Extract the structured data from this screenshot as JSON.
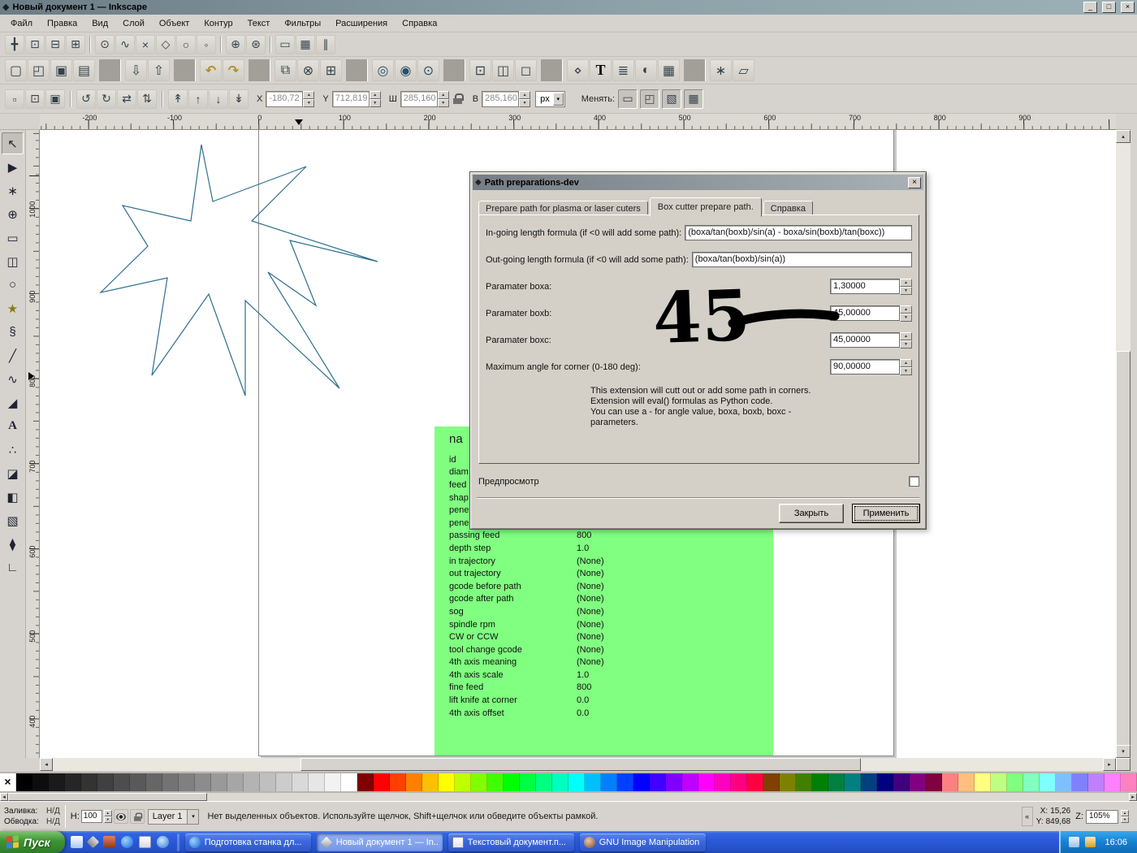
{
  "colors": {
    "ui_gray": "#d6d3ce",
    "dialog_gray": "#d4d0c8",
    "panel_green": "#80ff80",
    "taskbar_blue": "#2b59d8",
    "star_stroke": "#2e6f8e"
  },
  "titlebar": {
    "logo_glyph": "◆",
    "title": "Новый документ 1 — Inkscape",
    "minimize": "_",
    "maximize": "□",
    "close": "×"
  },
  "menubar": {
    "items": [
      "Файл",
      "Правка",
      "Вид",
      "Слой",
      "Объект",
      "Контур",
      "Текст",
      "Фильтры",
      "Расширения",
      "Справка"
    ]
  },
  "snapbar": {
    "icons": [
      {
        "name": "snap-enable-icon",
        "glyph": "╋"
      },
      {
        "name": "snap-bbox-icon",
        "glyph": "⊡"
      },
      {
        "name": "snap-bbox-edges-icon",
        "glyph": "⊟"
      },
      {
        "name": "snap-bbox-corners-icon",
        "glyph": "⊞"
      },
      {
        "name": "toolbar-separator",
        "glyph": ""
      },
      {
        "name": "snap-nodes-icon",
        "glyph": "⊙"
      },
      {
        "name": "snap-paths-icon",
        "glyph": "∿"
      },
      {
        "name": "snap-intersections-icon",
        "glyph": "×"
      },
      {
        "name": "snap-cusp-nodes-icon",
        "glyph": "◇"
      },
      {
        "name": "snap-smooth-nodes-icon",
        "glyph": "○"
      },
      {
        "name": "snap-midpoints-icon",
        "glyph": "◦"
      },
      {
        "name": "toolbar-separator",
        "glyph": ""
      },
      {
        "name": "snap-object-centers-icon",
        "glyph": "⊕"
      },
      {
        "name": "snap-rotation-centers-icon",
        "glyph": "⊛"
      },
      {
        "name": "toolbar-separator",
        "glyph": ""
      },
      {
        "name": "snap-page-border-icon",
        "glyph": "▭"
      },
      {
        "name": "snap-grid-icon",
        "glyph": "▦"
      },
      {
        "name": "snap-guides-icon",
        "glyph": "∥"
      }
    ]
  },
  "commands": {
    "icons": [
      {
        "name": "new-document-icon",
        "glyph": "▢"
      },
      {
        "name": "open-document-icon",
        "glyph": "◰"
      },
      {
        "name": "save-document-icon",
        "glyph": "▣"
      },
      {
        "name": "print-icon",
        "glyph": "▤"
      },
      {
        "name": "toolbar-separator",
        "glyph": ""
      },
      {
        "name": "import-icon",
        "glyph": "⇩"
      },
      {
        "name": "export-icon",
        "glyph": "⇧"
      },
      {
        "name": "toolbar-separator",
        "glyph": ""
      },
      {
        "name": "undo-icon",
        "glyph": "↶"
      },
      {
        "name": "redo-icon",
        "glyph": "↷"
      },
      {
        "name": "toolbar-separator",
        "glyph": ""
      },
      {
        "name": "copy-icon",
        "glyph": "⧉"
      },
      {
        "name": "cut-icon",
        "glyph": "⊗"
      },
      {
        "name": "paste-icon",
        "glyph": "⊞"
      },
      {
        "name": "toolbar-separator",
        "glyph": ""
      },
      {
        "name": "zoom-selection-icon",
        "glyph": "◎"
      },
      {
        "name": "zoom-drawing-icon",
        "glyph": "◉"
      },
      {
        "name": "zoom-page-icon",
        "glyph": "⊙"
      },
      {
        "name": "toolbar-separator",
        "glyph": ""
      },
      {
        "name": "duplicate-icon",
        "glyph": "⊡"
      },
      {
        "name": "create-clone-icon",
        "glyph": "◫"
      },
      {
        "name": "unlink-clone-icon",
        "glyph": "◻"
      },
      {
        "name": "toolbar-separator",
        "glyph": ""
      },
      {
        "name": "xml-editor-icon",
        "glyph": "⋄"
      },
      {
        "name": "text-and-font-icon",
        "glyph": "T"
      },
      {
        "name": "layers-dialog-icon",
        "glyph": "≣"
      },
      {
        "name": "fill-stroke-dialog-icon",
        "glyph": "◐"
      },
      {
        "name": "align-dialog-icon",
        "glyph": "▦"
      },
      {
        "name": "toolbar-separator",
        "glyph": ""
      },
      {
        "name": "preferences-icon",
        "glyph": "∗"
      },
      {
        "name": "document-properties-icon",
        "glyph": "▱"
      }
    ]
  },
  "tool_controls": {
    "select_icons": [
      {
        "name": "select-all-icon",
        "glyph": "▫"
      },
      {
        "name": "select-all-layers-icon",
        "glyph": "⊡"
      },
      {
        "name": "deselect-icon",
        "glyph": "▣"
      }
    ],
    "transform_icons": [
      {
        "name": "rotate-ccw-icon",
        "glyph": "↺"
      },
      {
        "name": "rotate-cw-icon",
        "glyph": "↻"
      },
      {
        "name": "flip-horizontal-icon",
        "glyph": "⇄"
      },
      {
        "name": "flip-vertical-icon",
        "glyph": "⇅"
      }
    ],
    "zorder_icons": [
      {
        "name": "raise-to-top-icon",
        "glyph": "↟"
      },
      {
        "name": "raise-icon",
        "glyph": "↑"
      },
      {
        "name": "lower-icon",
        "glyph": "↓"
      },
      {
        "name": "lower-to-bottom-icon",
        "glyph": "↡"
      }
    ],
    "x_label": "X",
    "x_value": "-180,72",
    "y_label": "Y",
    "y_value": "712,819",
    "w_label": "Ш",
    "w_value": "285,160",
    "h_label": "В",
    "h_value": "285,160",
    "units": "px",
    "affect_label": "Менять:",
    "affect_icons": [
      {
        "name": "scale-stroke-toggle-icon",
        "glyph": "▭"
      },
      {
        "name": "scale-corners-toggle-icon",
        "glyph": "◰"
      },
      {
        "name": "move-gradients-toggle-icon",
        "glyph": "▧"
      },
      {
        "name": "move-patterns-toggle-icon",
        "glyph": "▦"
      }
    ]
  },
  "rulers": {
    "h_labels": [
      "-200",
      "-100",
      "0",
      "100",
      "200",
      "300",
      "400",
      "500",
      "600",
      "700",
      "800",
      "900"
    ],
    "v_labels": [
      "1000",
      "900",
      "800",
      "700",
      "600",
      "500",
      "400"
    ]
  },
  "toolbox": {
    "tools": [
      {
        "name": "tool-selector",
        "glyph": "↖"
      },
      {
        "name": "tool-node-editor",
        "glyph": "▶"
      },
      {
        "name": "tool-tweak",
        "glyph": "∗"
      },
      {
        "name": "tool-zoom",
        "glyph": "⊕"
      },
      {
        "name": "tool-rectangle",
        "glyph": "▭"
      },
      {
        "name": "tool-3dbox",
        "glyph": "◫"
      },
      {
        "name": "tool-ellipse",
        "glyph": "○"
      },
      {
        "name": "tool-star",
        "glyph": "★"
      },
      {
        "name": "tool-spiral",
        "glyph": "§"
      },
      {
        "name": "tool-pencil",
        "glyph": "╱"
      },
      {
        "name": "tool-bezier-pen",
        "glyph": "∿"
      },
      {
        "name": "tool-calligraphy",
        "glyph": "◢"
      },
      {
        "name": "tool-text",
        "glyph": "A"
      },
      {
        "name": "tool-spray",
        "glyph": "∴"
      },
      {
        "name": "tool-eraser",
        "glyph": "◪"
      },
      {
        "name": "tool-paint-bucket",
        "glyph": "◧"
      },
      {
        "name": "tool-gradient",
        "glyph": "▧"
      },
      {
        "name": "tool-dropper",
        "glyph": "⧫"
      },
      {
        "name": "tool-connector",
        "glyph": "∟"
      }
    ]
  },
  "green_panel": {
    "header": "na",
    "rows": [
      {
        "label": "id",
        "value": ""
      },
      {
        "label": "diam",
        "value": ""
      },
      {
        "label": "feed",
        "value": ""
      },
      {
        "label": "shap",
        "value": ""
      },
      {
        "label": "pene",
        "value": ""
      },
      {
        "label": "pene",
        "value": ""
      },
      {
        "label": "passing feed",
        "value": "800"
      },
      {
        "label": "depth step",
        "value": "1.0"
      },
      {
        "label": "in trajectory",
        "value": "(None)"
      },
      {
        "label": "out trajectory",
        "value": "(None)"
      },
      {
        "label": "gcode before path",
        "value": "(None)"
      },
      {
        "label": "gcode after path",
        "value": "(None)"
      },
      {
        "label": "sog",
        "value": "(None)"
      },
      {
        "label": "spindle rpm",
        "value": "(None)"
      },
      {
        "label": "CW or CCW",
        "value": "(None)"
      },
      {
        "label": "tool change gcode",
        "value": "(None)"
      },
      {
        "label": "4th axis meaning",
        "value": "(None)"
      },
      {
        "label": "4th axis scale",
        "value": "1.0"
      },
      {
        "label": "fine feed",
        "value": "800"
      },
      {
        "label": "lift knife at corner",
        "value": "0.0"
      },
      {
        "label": "4th axis offset",
        "value": "0.0"
      }
    ]
  },
  "dialog": {
    "logo_glyph": "◆",
    "title": "Path preparations-dev",
    "close_glyph": "×",
    "tabs": [
      "Prepare path for plasma or laser cuters",
      "Box cutter prepare path.",
      "Справка"
    ],
    "formula_rows": [
      {
        "label": "In-going length formula (if <0 will add some path):",
        "value": "(boxa/tan(boxb)/sin(a) - boxa/sin(boxb)/tan(boxc))"
      },
      {
        "label": "Out-going length formula (if <0 will add some path):",
        "value": "(boxa/tan(boxb)/sin(a))"
      }
    ],
    "param_rows": [
      {
        "label": "Paramater boxa:",
        "value": "1,30000"
      },
      {
        "label": "Paramater boxb:",
        "value": "45,00000"
      },
      {
        "label": "Paramater boxc:",
        "value": "45,00000"
      },
      {
        "label": "Maximum angle for corner (0-180 deg):",
        "value": "90,00000"
      }
    ],
    "help_lines": [
      "This extension will cutt out or add some path in corners.",
      "Extension will eval() formulas as Python code.",
      "You can use a - for angle value, boxa, boxb, boxc -",
      "parameters."
    ],
    "preview_label": "Предпросмотр",
    "close_button": "Закрыть",
    "apply_button": "Применить",
    "annotation": "45"
  },
  "palette": {
    "none_glyph": "×",
    "colors": [
      "#000000",
      "#0d0d0d",
      "#1a1a1a",
      "#262626",
      "#333333",
      "#404040",
      "#4d4d4d",
      "#595959",
      "#666666",
      "#737373",
      "#808080",
      "#8c8c8c",
      "#999999",
      "#a6a6a6",
      "#b3b3b3",
      "#bfbfbf",
      "#cccccc",
      "#d9d9d9",
      "#e6e6e6",
      "#f2f2f2",
      "#ffffff",
      "#800000",
      "#ff0000",
      "#ff4000",
      "#ff8000",
      "#ffbf00",
      "#ffff00",
      "#bfff00",
      "#80ff00",
      "#40ff00",
      "#00ff00",
      "#00ff40",
      "#00ff80",
      "#00ffbf",
      "#00ffff",
      "#00bfff",
      "#0080ff",
      "#0040ff",
      "#0000ff",
      "#4000ff",
      "#8000ff",
      "#bf00ff",
      "#ff00ff",
      "#ff00bf",
      "#ff0080",
      "#ff0040",
      "#804000",
      "#808000",
      "#408000",
      "#008000",
      "#008040",
      "#008080",
      "#004080",
      "#000080",
      "#400080",
      "#800080",
      "#800040",
      "#ff8080",
      "#ffbf80",
      "#ffff80",
      "#bfff80",
      "#80ff80",
      "#80ffbf",
      "#80ffff",
      "#80bfff",
      "#8080ff",
      "#bf80ff",
      "#ff80ff",
      "#ff80bf"
    ]
  },
  "statusbar": {
    "fill_label": "Заливка:",
    "fill_value": "Н/Д",
    "stroke_label": "Обводка:",
    "stroke_value": "Н/Д",
    "opacity_label": "Н:",
    "opacity_value": "100",
    "layer_name": "Layer 1",
    "message": "Нет выделенных объектов. Используйте щелчок, Shift+щелчок или обведите объекты рамкой.",
    "collapse_glyph": "«",
    "x_label": "X:",
    "x_value": "15,26",
    "y_label": "Y:",
    "y_value": "849,68",
    "z_label": "Z:",
    "zoom_value": "105%"
  },
  "taskbar": {
    "start_label": "Пуск",
    "tasks": [
      {
        "label": "Подготовка станка дл...",
        "active": false
      },
      {
        "label": "Новый документ 1 — In...",
        "active": true
      },
      {
        "label": "Текстовый документ.п...",
        "active": false
      },
      {
        "label": "GNU Image Manipulation ...",
        "active": false
      }
    ],
    "clock": "16:06"
  }
}
